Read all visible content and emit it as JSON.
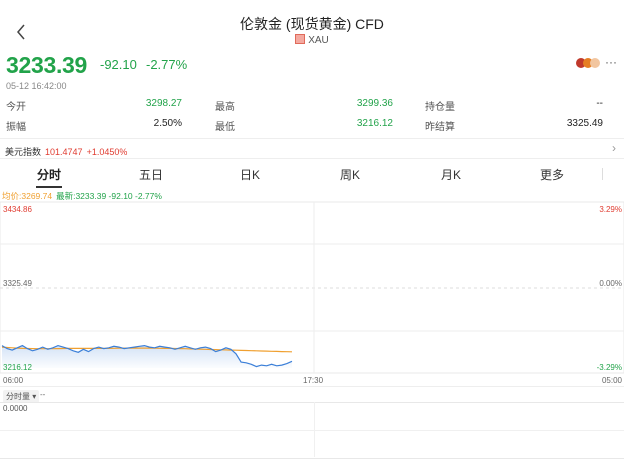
{
  "header": {
    "title": "伦敦金 (现货黄金) CFD",
    "symbol": "XAU"
  },
  "quote": {
    "price": "3233.39",
    "change": "-92.10",
    "change_pct": "-2.77%",
    "timestamp": "05-12 16:42:00",
    "more_label": "···"
  },
  "stats": {
    "open_label": "今开",
    "open_value": "3298.27",
    "high_label": "最高",
    "high_value": "3299.36",
    "oi_label": "持仓量",
    "oi_value": "--",
    "amp_label": "振幅",
    "amp_value": "2.50%",
    "low_label": "最低",
    "low_value": "3216.12",
    "prev_label": "昨结算",
    "prev_value": "3325.49"
  },
  "index_bar": {
    "name": "美元指数",
    "value": "101.4747",
    "change": "+1.0450%"
  },
  "tabs": [
    {
      "label": "分时",
      "active": true
    },
    {
      "label": "五日",
      "active": false
    },
    {
      "label": "日K",
      "active": false
    },
    {
      "label": "周K",
      "active": false
    },
    {
      "label": "月K",
      "active": false
    },
    {
      "label": "更多",
      "active": false
    }
  ],
  "chart_legend": {
    "avg": "均价:3269.74",
    "latest": "最新:3233.39 -92.10 -2.77%"
  },
  "chart_axes": {
    "y_top": "3434.86",
    "y_mid": "3325.49",
    "y_bottom": "3216.12",
    "pct_top": "3.29%",
    "pct_mid": "0.00%",
    "pct_bottom": "-3.29%",
    "x_start": "06:00",
    "x_mid": "17:30",
    "x_end": "05:00"
  },
  "volume": {
    "label": "分时量",
    "dash": "--",
    "value": "0.0000"
  },
  "colors": {
    "up": "#e03c31",
    "down": "#22a34a",
    "price_line": "#3b7fd8",
    "avg_line": "#f0a030"
  },
  "chart_data": {
    "type": "line",
    "title": "",
    "xlabel": "",
    "ylabel": "",
    "ylim": [
      3216.12,
      3434.86
    ],
    "x_ticks": [
      "06:00",
      "17:30",
      "05:00"
    ],
    "series": [
      {
        "values": [
          3246,
          3242,
          3240,
          3243,
          3246,
          3242,
          3239,
          3241,
          3244,
          3241,
          3243,
          3246,
          3244,
          3242,
          3239,
          3237,
          3241,
          3238,
          3242,
          3244,
          3242,
          3243,
          3245,
          3244,
          3242,
          3243,
          3244,
          3245,
          3246,
          3244,
          3243,
          3245,
          3244,
          3243,
          3241,
          3243,
          3245,
          3243,
          3241,
          3243,
          3244,
          3242,
          3238,
          3240,
          3243,
          3241,
          3235,
          3224,
          3223,
          3221,
          3218,
          3220,
          3219,
          3221,
          3219,
          3220,
          3222,
          3225
        ]
      },
      {
        "values": [
          3244,
          3243.5,
          3243,
          3242.6,
          3242.3,
          3242.1,
          3242,
          3241.9,
          3241.8,
          3241.8,
          3241.9,
          3242,
          3242.1,
          3242.2,
          3242.3,
          3242.3,
          3242.3,
          3242.3,
          3242.3,
          3242.3,
          3242.3,
          3242.3,
          3242.4,
          3242.5,
          3242.6,
          3242.6,
          3242.6,
          3242.6,
          3242.6,
          3242.6,
          3242.5,
          3242.4,
          3242.3,
          3242.2,
          3242.1,
          3242,
          3241.8,
          3241.6,
          3241.4,
          3241.2,
          3241,
          3240.8,
          3240.6,
          3240.4,
          3240.2,
          3240,
          3239.8,
          3239.6,
          3239.4,
          3239.2,
          3239,
          3238.8,
          3238.6,
          3238.4,
          3238.2,
          3238,
          3237.8,
          3237.7
        ]
      }
    ]
  }
}
